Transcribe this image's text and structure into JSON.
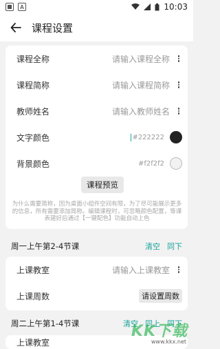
{
  "status": {
    "time": "10:03",
    "left_icons": [
      "notification-icon",
      "text-a-icon"
    ],
    "right_icons": [
      "wifi-icon",
      "signal-icon",
      "battery-icon"
    ],
    "a_label": "A"
  },
  "appbar": {
    "title": "课程设置",
    "back_icon": "back-arrow-icon"
  },
  "settings": {
    "course_full_name_label": "课程全称",
    "course_full_name_placeholder": "请输入课程全称",
    "course_short_name_label": "课程简称",
    "course_short_name_placeholder": "请输入课程简称",
    "teacher_label": "教师姓名",
    "teacher_placeholder": "请输入教师姓名",
    "text_color_label": "文字颜色",
    "text_color_value": "#222222",
    "bg_color_label": "背景颜色",
    "bg_color_value": "#f2f2f2",
    "preview_button": "课程预览",
    "note": "为什么需要简称，因为桌面小组件空间有限，为了尽可能展示更多的信息，所有需要添加简称。编辑课程时，可忽略颜色配置，等课表建好后通过【一键配色】功能自动上色"
  },
  "lessons": [
    {
      "title": "周一上午第2-4节课",
      "actions": [
        "清空",
        "同下"
      ],
      "classroom_label": "上课教室",
      "classroom_placeholder": "请输入上课教室",
      "weeks_label": "上课周数",
      "weeks_button": "请设置周数"
    },
    {
      "title": "周二上午第1-4节课",
      "actions": [
        "清空",
        "同上",
        "同下"
      ],
      "classroom_label": "上课教室"
    }
  ],
  "watermark": {
    "text": "KK下载",
    "url": "www.kkx.net"
  },
  "colors": {
    "accent": "#1aa39a",
    "text_swatch": "#222222",
    "bg_swatch": "#f2f2f2"
  }
}
